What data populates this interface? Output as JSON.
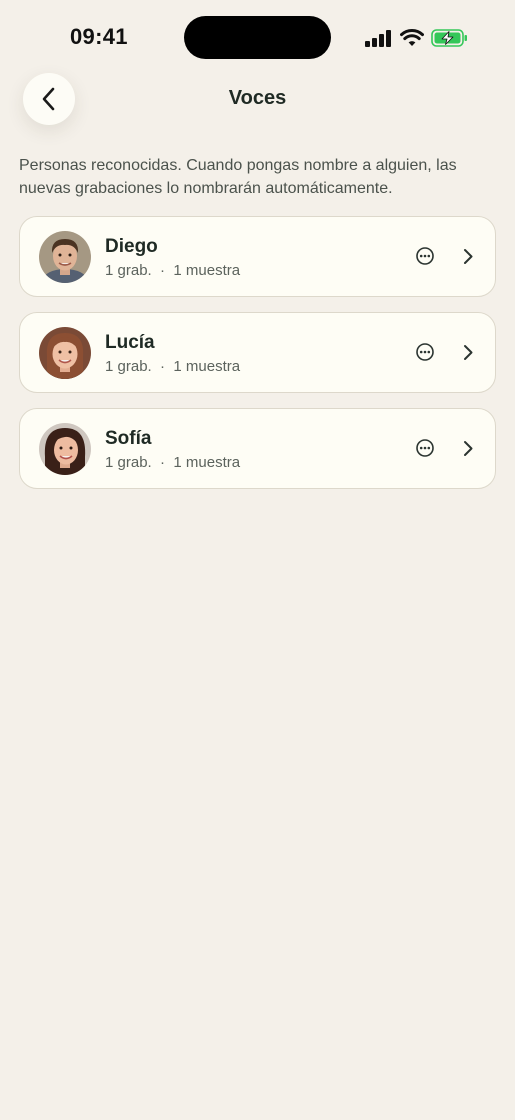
{
  "status_bar": {
    "time": "09:41"
  },
  "header": {
    "title": "Voces",
    "back_icon": "chevron-left-icon"
  },
  "description": "Personas reconocidas. Cuando pongas nombre a alguien, las nuevas grabaciones lo nombrarán automáticamente.",
  "voices": [
    {
      "name": "Diego",
      "recordings": "1 grab.",
      "separator": "·",
      "samples": "1 muestra"
    },
    {
      "name": "Lucía",
      "recordings": "1 grab.",
      "separator": "·",
      "samples": "1 muestra"
    },
    {
      "name": "Sofía",
      "recordings": "1 grab.",
      "separator": "·",
      "samples": "1 muestra"
    }
  ],
  "colors": {
    "background": "#f4f0e9",
    "card": "#fefdf5",
    "text": "#1f2a24",
    "battery": "#34c759"
  }
}
